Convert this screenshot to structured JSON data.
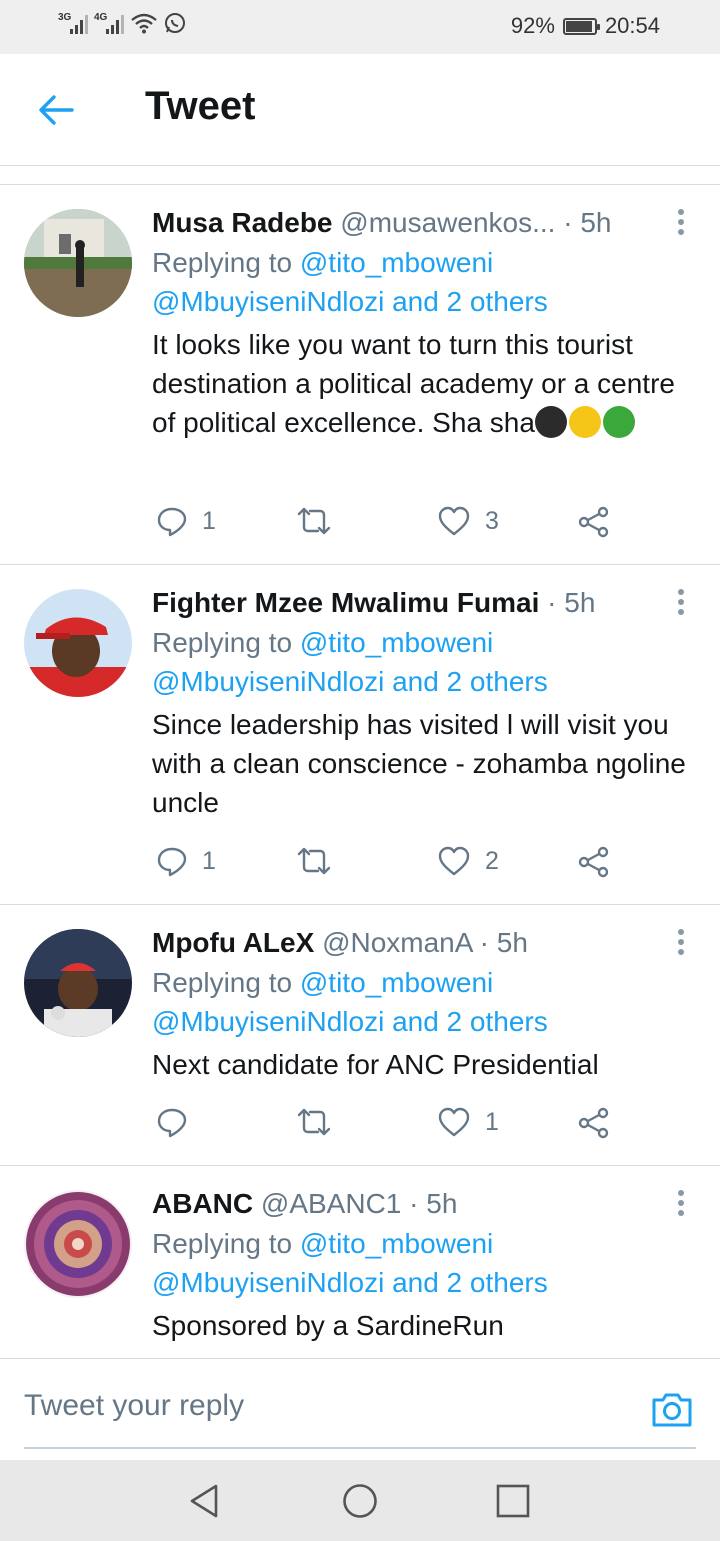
{
  "status_bar": {
    "network1": "3G",
    "network2": "4G",
    "battery": "92%",
    "battery_level": 0.92,
    "time": "20:54"
  },
  "header": {
    "title": "Tweet",
    "back_icon": "arrow-left-icon"
  },
  "tweets": [
    {
      "name": "Musa Radebe",
      "handle": "@musawenkos...",
      "time": "· 5h",
      "replying_label": "Replying to",
      "replying_user": "@tito_mboweni",
      "replying_others": "@MbuyiseniNdlozi and 2 others",
      "text": "It looks like you want to turn this tourist destination a political academy or a centre of political excellence. Sha sha",
      "emojis": [
        "#2b2b2b",
        "#f5c518",
        "#3aa83a"
      ],
      "replies": "1",
      "retweets": "",
      "likes": "3"
    },
    {
      "name": "Fighter Mzee Mwalimu Fumai",
      "handle": "",
      "time": "· 5h",
      "replying_label": "Replying to",
      "replying_user": "@tito_mboweni",
      "replying_others": "@MbuyiseniNdlozi and 2 others",
      "text": "Since leadership has visited l will visit you with a clean conscience - zohamba ngoline uncle",
      "replies": "1",
      "retweets": "",
      "likes": "2"
    },
    {
      "name": "Mpofu ALeX",
      "handle": "@NoxmanA",
      "time": "· 5h",
      "replying_label": "Replying to",
      "replying_user": "@tito_mboweni",
      "replying_others": "@MbuyiseniNdlozi and 2 others",
      "text": "Next candidate for ANC Presidential",
      "replies": "",
      "retweets": "",
      "likes": "1"
    },
    {
      "name": "ABANC",
      "handle": "@ABANC1",
      "time": "· 5h",
      "replying_label": "Replying to",
      "replying_user": "@tito_mboweni",
      "replying_others": "@MbuyiseniNdlozi and 2 others",
      "text": "Sponsored by a SardineRun"
    }
  ],
  "reply_bar": {
    "placeholder": "Tweet your reply",
    "camera_icon": "camera-icon"
  },
  "colors": {
    "accent": "#1da1f2",
    "muted": "#657786",
    "text": "#14171a"
  }
}
